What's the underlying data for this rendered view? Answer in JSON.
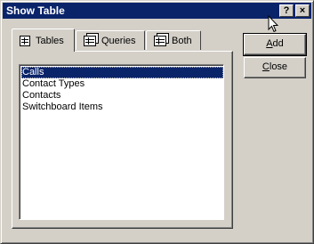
{
  "window": {
    "title": "Show Table"
  },
  "titlebar_buttons": {
    "help": "?",
    "close": "×"
  },
  "tabs": [
    {
      "label": "Tables",
      "icon": "table-icon"
    },
    {
      "label": "Queries",
      "icon": "query-icon"
    },
    {
      "label": "Both",
      "icon": "both-icon"
    }
  ],
  "list": {
    "items": [
      "Calls",
      "Contact Types",
      "Contacts",
      "Switchboard Items"
    ],
    "selected_index": 0
  },
  "buttons": {
    "add": {
      "first": "A",
      "rest": "dd"
    },
    "close": {
      "first": "C",
      "rest": "lose"
    }
  },
  "colors": {
    "titlebar": "#0a246a",
    "face": "#d4d0c8",
    "selection": "#0a246a"
  }
}
